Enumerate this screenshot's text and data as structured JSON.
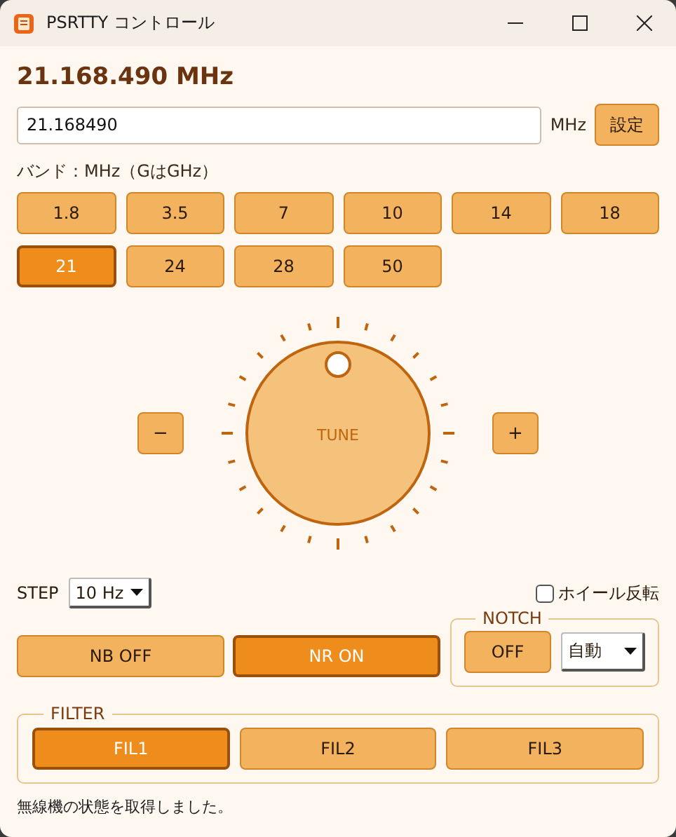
{
  "window": {
    "title": "PSRTTY コントロール"
  },
  "frequency_display": "21.168.490 MHz",
  "frequency_input": {
    "value": "21.168490",
    "unit": "MHz",
    "button": "設定"
  },
  "band_label": "バンド：MHz（GはGHz）",
  "bands": [
    {
      "label": "1.8",
      "selected": false
    },
    {
      "label": "3.5",
      "selected": false
    },
    {
      "label": "7",
      "selected": false
    },
    {
      "label": "10",
      "selected": false
    },
    {
      "label": "14",
      "selected": false
    },
    {
      "label": "18",
      "selected": false
    },
    {
      "label": "21",
      "selected": true
    },
    {
      "label": "24",
      "selected": false
    },
    {
      "label": "28",
      "selected": false
    },
    {
      "label": "50",
      "selected": false
    }
  ],
  "tuner": {
    "minus": "−",
    "plus": "+",
    "knob": "TUNE"
  },
  "step": {
    "label": "STEP",
    "value": "10 Hz"
  },
  "wheel_reverse": {
    "label": "ホイール反転",
    "checked": false
  },
  "nb": {
    "label": "NB OFF",
    "on": false
  },
  "nr": {
    "label": "NR ON",
    "on": true
  },
  "notch": {
    "title": "NOTCH",
    "button": {
      "label": "OFF",
      "on": false
    },
    "mode": "自動"
  },
  "filter": {
    "title": "FILTER",
    "buttons": [
      {
        "label": "FIL1",
        "selected": true
      },
      {
        "label": "FIL2",
        "selected": false
      },
      {
        "label": "FIL3",
        "selected": false
      }
    ]
  },
  "status_bar": "無線機の状態を取得しました。"
}
